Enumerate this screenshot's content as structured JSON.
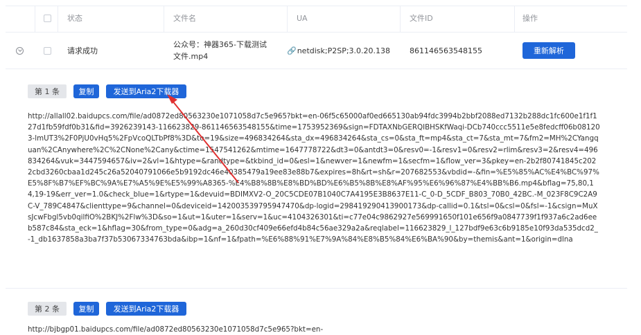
{
  "table": {
    "headers": {
      "status": "状态",
      "filename": "文件名",
      "ua": "UA",
      "file_id": "文件ID",
      "actions": "操作"
    },
    "row": {
      "status": "请求成功",
      "filename_line1": "公众号：神器365-下载测试",
      "filename_line2": "文件.mp4",
      "ua": "netdisk;P2SP;3.0.20.138",
      "file_id": "861146563548155",
      "reparse_label": "重新解析"
    }
  },
  "links": [
    {
      "index_label": "第 1 条",
      "copy_label": "复制",
      "send_label": "发送到Aria2下载器",
      "url": "http://allall02.baidupcs.com/file/ad0872ed80563230e1071058d7c5e965?bkt=en-06f5c65000af0ed665130ab94fdc3994b2bbf2088ed7132b288dc1fc600e1f1f127d1fb59fdf0b31&fid=3926239143-116623829-861146563548155&time=1753952369&sign=FDTAXNbGERQIBHSKfWaqi-DCb740ccc5511e5e8fedcff06b081203-lmUT3%2F0PjU0vHq5%2FpVcoQLTbPf8%3D&to=19&size=496834264&sta_dx=496834264&sta_cs=0&sta_ft=mp4&sta_ct=7&sta_mt=7&fm2=MH%2CYangquan%2CAnywhere%2C%2CNone%2Cany&ctime=1547541262&mtime=1647778722&dt3=0&antdt3=0&resv0=-1&resv1=0&resv2=rlim&resv3=2&resv4=496834264&vuk=3447594657&iv=2&vl=1&htype=&randtype=&tkbind_id=0&esl=1&newver=1&newfm=1&secfm=1&flow_ver=3&pkey=en-2b2f80741845c2022cbd3260cbaa1d245c26a52040791066e5b9192dc46e40385479a19ee83e88b7&expires=8h&rt=sh&r=207682553&vbdid=-&fin=%E5%85%AC%E4%BC%97%E5%8F%B7%EF%BC%9A%E7%A5%9E%E5%99%A8365-%E4%B8%8B%E8%BD%BD%E6%B5%8B%E8%AF%95%E6%96%87%E4%BB%B6.mp4&bflag=75,80,14,19-19&err_ver=1.0&check_blue=1&rtype=1&devuid=BDIMXV2-O_20C5CDE07B1040C7A4195E3B8637E11-C_0-D_5CDF_B803_70B0_42BC.-M_023F8C9C2A9C-V_789C4847&clienttype=9&channel=0&deviceid=142003539795947470&dp-logid=298419290413900173&dp-callid=0.1&tsl=0&csl=0&fsl=-1&csign=MuXsJcwFbgl5vb0qilfiO%2BKJ%2Flw%3D&so=1&ut=1&uter=1&serv=1&uc=4104326301&ti=c77e04c9862927e569991650f101e656f9a0847739f1f937a6c2ad6eeb587c84&sta_eck=1&hflag=30&from_type=0&adg=a_260d30cf409e66efd4b84c56ae329a2a&reqlabel=116623829_l_127bdf9e63c6b9185e10f93da535dcd2_-1_db1637858a3ba7f37b53067334763bda&ibp=1&nf=1&fpath=%E6%88%91%E7%9A%84%E8%B5%84%E6%BA%90&by=themis&ant=1&origin=dlna"
    },
    {
      "index_label": "第 2 条",
      "copy_label": "复制",
      "send_label": "发送到Aria2下载器",
      "url": "http://bjbgp01.baidupcs.com/file/ad0872ed80563230e1071058d7c5e965?bkt=en-"
    }
  ],
  "colors": {
    "primary": "#1f66d9",
    "annotation_arrow": "#e03030"
  }
}
